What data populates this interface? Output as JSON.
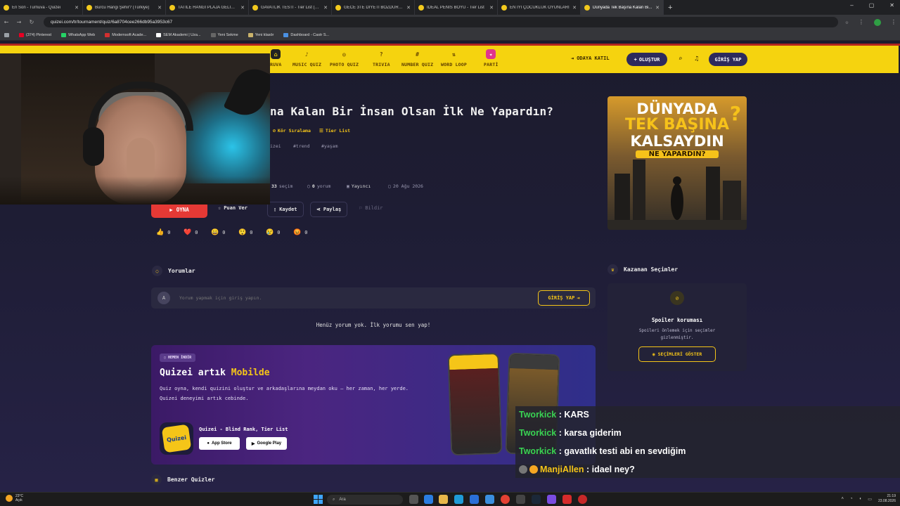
{
  "browser": {
    "tabs": [
      {
        "title": "En Son - Turnuva - Quizei",
        "active": false
      },
      {
        "title": "Burcu Hangi Şehir? (Türkiye)",
        "active": false
      },
      {
        "title": "TATİLE HANGİ PLAJA GELİRSİN",
        "active": false
      },
      {
        "title": "GAVATLIK TESTİ - Tier List (Kör)",
        "active": false
      },
      {
        "title": "GECE 3TE DİYETİ BOZDURUCAK",
        "active": false
      },
      {
        "title": "İDEAL PENİS BOYU - Tier List",
        "active": false
      },
      {
        "title": "EN İYİ ÇOCUKLUK OYUNLARI",
        "active": false
      },
      {
        "title": "Dünyada Tek Başına Kalan Bi...",
        "active": true
      }
    ],
    "new_tab": "+",
    "window_controls": [
      "–",
      "▢",
      "✕"
    ],
    "url": "quizei.com/tr/tournament/quiz/6a8704cee266db95a3953c67",
    "bookmarks": [
      "(374) Pinterest",
      "WhatsApp Web",
      "Modernsoft Acade...",
      "SEM Akademi | Uza...",
      "Yeni Sekme",
      "Yeni klasör",
      "Dashboard - Castr S..."
    ]
  },
  "nav": {
    "items": [
      {
        "label": "RUVA",
        "icon": "trophy-icon"
      },
      {
        "label": "MUSIC QUIZ",
        "icon": "music-icon"
      },
      {
        "label": "PHOTO QUIZ",
        "icon": "camera-icon"
      },
      {
        "label": "TRIVIA",
        "icon": "question-icon"
      },
      {
        "label": "NUMBER QUIZ",
        "icon": "hash-icon"
      },
      {
        "label": "WORD LOOP",
        "icon": "loop-icon"
      },
      {
        "label": "PARTİ",
        "icon": "party-icon"
      }
    ],
    "join_label": "ODAYA KATIL",
    "create_label": "OLUŞTUR",
    "login_label": "GİRİŞ YAP"
  },
  "quiz": {
    "title": "na Kalan Bir İnsan Olsan İlk Ne Yapardın?",
    "mode_labels": [
      "Kör Sıralama",
      "Tier List"
    ],
    "tags": [
      "izei",
      "#trend",
      "#yaşam"
    ],
    "selection_count": "33",
    "selection_label": "seçim",
    "comment_count": "0",
    "comment_label": "yorum",
    "publisher": "Yayıncı",
    "date": "20 Ağu 2026"
  },
  "actions": {
    "play": "OYNA",
    "rate": "Puan Ver",
    "save": "Kaydet",
    "share": "Paylaş",
    "report": "Bildir"
  },
  "reactions": [
    {
      "emoji": "👍",
      "count": "0"
    },
    {
      "emoji": "❤️",
      "count": "0"
    },
    {
      "emoji": "😄",
      "count": "0"
    },
    {
      "emoji": "😲",
      "count": "0"
    },
    {
      "emoji": "😢",
      "count": "0"
    },
    {
      "emoji": "😡",
      "count": "0"
    }
  ],
  "hero_image": {
    "line1": "DÜNYADA",
    "line2": "TEK BAŞINA",
    "line3": "KALSAYDIN",
    "line4": "NE YAPARDIN?",
    "qmark": "?"
  },
  "comments": {
    "heading": "Yorumlar",
    "avatar": "A",
    "placeholder": "Yorum yapmak için giriş yapın.",
    "login_btn": "GİRİŞ YAP",
    "empty": "Henüz yorum yok. İlk yorumu sen yap!"
  },
  "mobile": {
    "badge": "HEMEN İNDİR",
    "title_prefix": "Quizei artık ",
    "title_highlight": "Mobilde",
    "description": "Quiz oyna, kendi quizini oluştur ve arkadaşlarına meydan oku — her zaman, her yerde. Quizei deneyimi artık cebinde.",
    "app_logo": "Quizei",
    "app_name": "Quizei - Blind Rank, Tier List",
    "app_store": "App Store",
    "google_play": "Google Play"
  },
  "similar": {
    "heading": "Benzer Quizler"
  },
  "winners": {
    "heading": "Kazanan Seçimler",
    "spoiler_title": "Spoiler koruması",
    "spoiler_desc": "Spoileri önlemek için seçimler gizlenmiştir.",
    "show_btn": "SEÇİMLERİ GÖSTER"
  },
  "chat": [
    {
      "user": "Tworkick",
      "message": ": KARS",
      "color": "#39d353"
    },
    {
      "user": "Tworkick",
      "message": ": karsa giderim",
      "color": "#39d353"
    },
    {
      "user": "Tworkick",
      "message": ": gavatlık testi abi en sevdiğim",
      "color": "#39d353"
    },
    {
      "user": "ManjiAllen",
      "message": ": idael ney?",
      "color": "#f5c518"
    }
  ],
  "taskbar": {
    "weather_temp": "23°C",
    "weather_desc": "Açık",
    "search": "Ara",
    "time": "21:19",
    "date": "23.08.2026"
  }
}
